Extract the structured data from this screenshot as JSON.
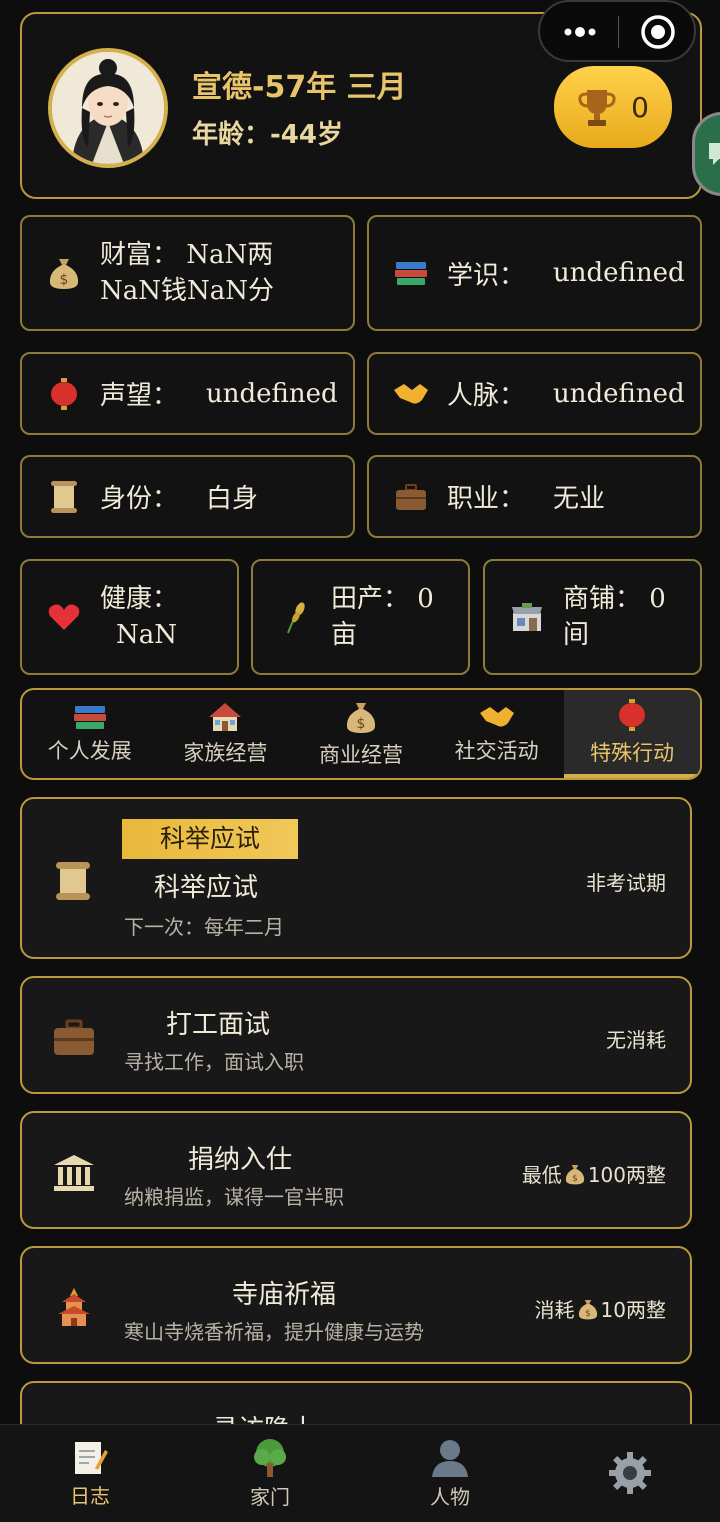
{
  "header": {
    "date": "宣德-57年 三月",
    "age": "年龄：-44岁",
    "trophy_count": "0"
  },
  "stats": {
    "wealth": {
      "label": "财富：",
      "value": "NaN两",
      "value2": "NaN钱NaN分",
      "icon": "money-bag-icon"
    },
    "knowledge": {
      "label": "学识：",
      "value": "undefined",
      "icon": "books-icon"
    },
    "reputation": {
      "label": "声望：",
      "value": "undefined",
      "icon": "lantern-icon"
    },
    "connections": {
      "label": "人脉：",
      "value": "undefined",
      "icon": "handshake-icon"
    },
    "status": {
      "label": "身份：",
      "value": "白身",
      "icon": "scroll-icon"
    },
    "job": {
      "label": "职业：",
      "value": "无业",
      "icon": "briefcase-icon"
    },
    "health": {
      "label": "健康：",
      "value": "NaN",
      "icon": "heart-icon"
    },
    "farmland": {
      "label": "田产：",
      "value": "0",
      "unit": "亩",
      "icon": "rice-icon"
    },
    "shops": {
      "label": "商铺：",
      "value": "0",
      "unit": "间",
      "icon": "store-icon"
    }
  },
  "tabs": [
    {
      "label": "个人发展",
      "icon": "books-icon"
    },
    {
      "label": "家族经营",
      "icon": "house-icon"
    },
    {
      "label": "商业经营",
      "icon": "money-bag-icon"
    },
    {
      "label": "社交活动",
      "icon": "handshake-icon"
    },
    {
      "label": "特殊行动",
      "icon": "lantern-icon",
      "active": true
    }
  ],
  "actions": [
    {
      "badge": "科举应试",
      "title": "科举应试",
      "desc": "下一次：每年二月",
      "right": "非考试期",
      "icon": "scroll-icon"
    },
    {
      "title": "打工面试",
      "desc": "寻找工作，面试入职",
      "right": "无消耗",
      "icon": "briefcase-icon"
    },
    {
      "title": "捐纳入仕",
      "desc": "纳粮捐监，谋得一官半职",
      "right_prefix": "最低",
      "right_value": "100两整",
      "icon": "government-building-icon"
    },
    {
      "title": "寺庙祈福",
      "desc": "寒山寺烧香祈福，提升健康与运势",
      "right_prefix": "消耗",
      "right_value": "10两整",
      "icon": "pagoda-icon"
    },
    {
      "title": "寻访隐士",
      "icon": "hermit-icon"
    }
  ],
  "nav": [
    {
      "label": "日志",
      "icon": "memo-icon",
      "active": true
    },
    {
      "label": "家门",
      "icon": "tree-icon"
    },
    {
      "label": "人物",
      "icon": "person-silhouette-icon"
    },
    {
      "label": "",
      "icon": "gear-icon"
    }
  ],
  "colors": {
    "accent": "#d4b04c",
    "background": "#0d0d0d",
    "card": "#121212",
    "badge": "#f0c85a"
  }
}
